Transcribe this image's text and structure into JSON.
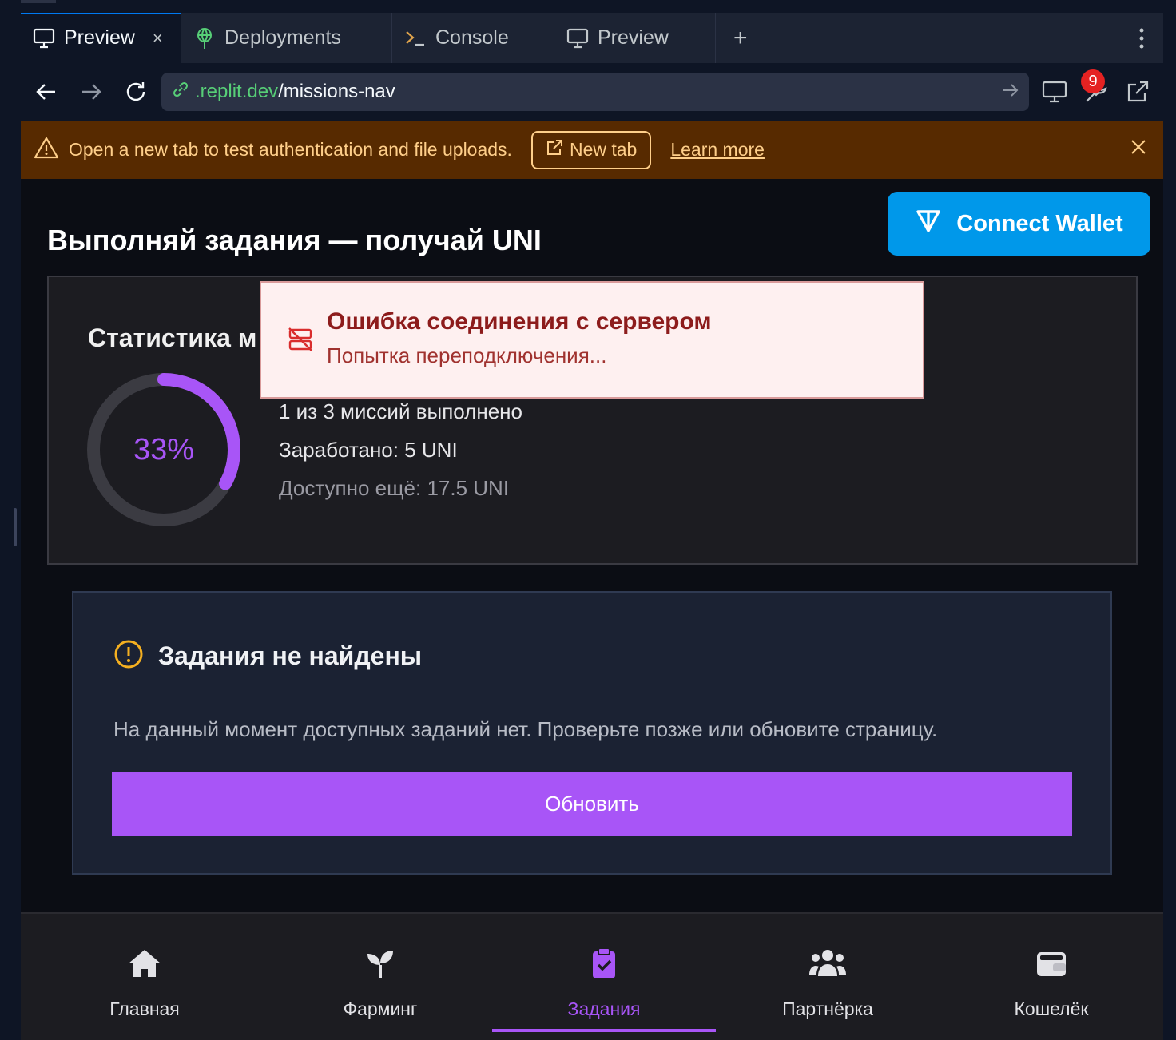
{
  "tabs": [
    {
      "label": "Preview",
      "active": true,
      "icon": "monitor-icon"
    },
    {
      "label": "Deployments",
      "active": false,
      "icon": "deployments-icon"
    },
    {
      "label": "Console",
      "active": false,
      "icon": "terminal-icon"
    },
    {
      "label": "Preview",
      "active": false,
      "icon": "monitor-icon"
    }
  ],
  "tab_close": "×",
  "tab_add": "+",
  "url": {
    "host": ".replit.dev",
    "path": "/missions-nav"
  },
  "devtools_badge": "9",
  "banner": {
    "message": "Open a new tab to test authentication and file uploads.",
    "new_tab_label": "New tab",
    "learn_more_label": "Learn more",
    "bg_color": "#572a00",
    "text_color": "#ffcf8a"
  },
  "app": {
    "title": "Выполняй задания — получай UNI",
    "connect_wallet_label": "Connect Wallet",
    "wallet_color": "#0098ea",
    "stats": {
      "title": "Статистика м",
      "progress_percent": 33,
      "progress_label": "33%",
      "completed_line": "1 из 3 миссий выполнено",
      "earned_line": "Заработано: 5 UNI",
      "available_line": "Доступно ещё: 17.5 UNI"
    },
    "toast": {
      "title": "Ошибка соединения с сервером",
      "subtitle": "Попытка переподключения..."
    },
    "empty": {
      "title": "Задания не найдены",
      "text": "На данный момент доступных заданий нет. Проверьте позже или обновите страницу.",
      "refresh_label": "Обновить"
    },
    "accent_color": "#a855f7",
    "nav": [
      {
        "label": "Главная",
        "icon": "home-icon",
        "active": false
      },
      {
        "label": "Фарминг",
        "icon": "sprout-icon",
        "active": false
      },
      {
        "label": "Задания",
        "icon": "clipboard-check-icon",
        "active": true
      },
      {
        "label": "Партнёрка",
        "icon": "users-icon",
        "active": false
      },
      {
        "label": "Кошелёк",
        "icon": "wallet-icon",
        "active": false
      }
    ]
  }
}
